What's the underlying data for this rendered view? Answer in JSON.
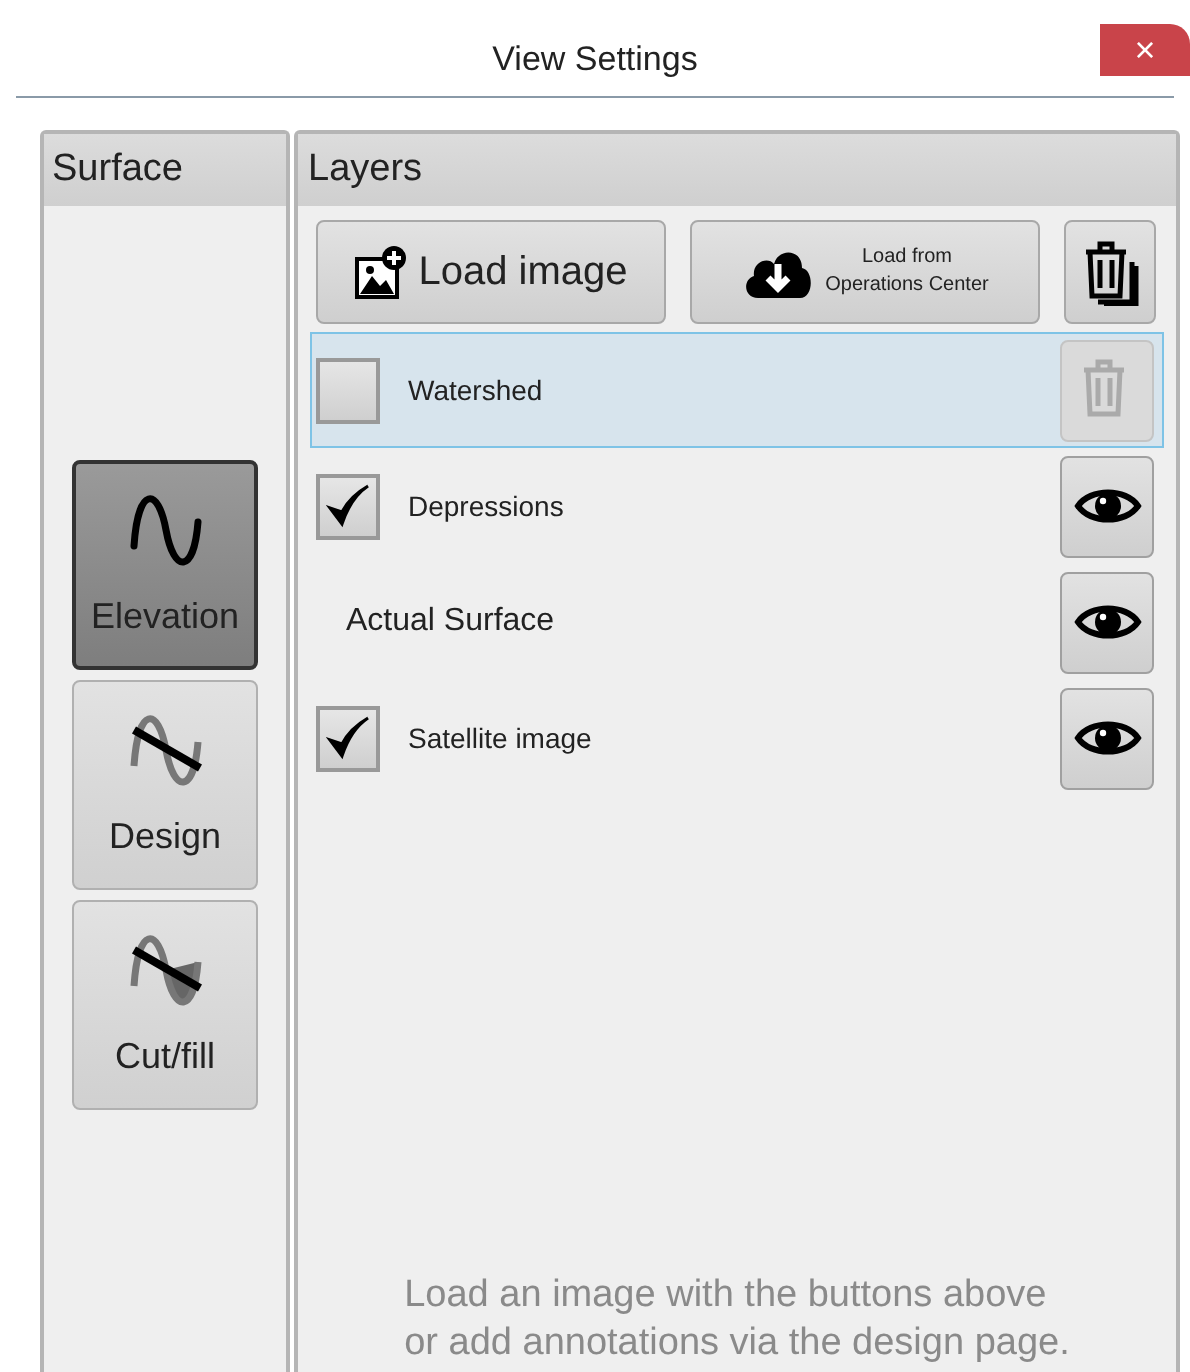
{
  "window": {
    "title": "View Settings",
    "close": "×"
  },
  "surface": {
    "title": "Surface",
    "items": [
      {
        "label": "Elevation",
        "kind": "wave",
        "selected": true
      },
      {
        "label": "Design",
        "kind": "design",
        "selected": false
      },
      {
        "label": "Cut/fill",
        "kind": "cutfill",
        "selected": false
      }
    ]
  },
  "layers": {
    "title": "Layers",
    "toolbar": [
      {
        "kind": "image",
        "label": "Load image"
      },
      {
        "kind": "cloud",
        "label": "Load from\nOperations Center"
      },
      {
        "kind": "trash-all"
      }
    ],
    "rows": [
      {
        "kind": "check",
        "label": "Watershed",
        "checked": false,
        "selected": true,
        "action": {
          "kind": "delete",
          "disabled": true
        }
      },
      {
        "kind": "check",
        "label": "Depressions",
        "checked": true,
        "selected": false,
        "action": {
          "kind": "eye",
          "disabled": false
        }
      },
      {
        "kind": "plain",
        "label": "Actual Surface",
        "selected": false,
        "action": {
          "kind": "eye",
          "disabled": false
        }
      },
      {
        "kind": "check",
        "label": "Satellite image",
        "checked": true,
        "selected": false,
        "action": {
          "kind": "eye",
          "disabled": false
        }
      }
    ],
    "hint": "Load an image with the buttons above\nor add annotations via the design page."
  }
}
